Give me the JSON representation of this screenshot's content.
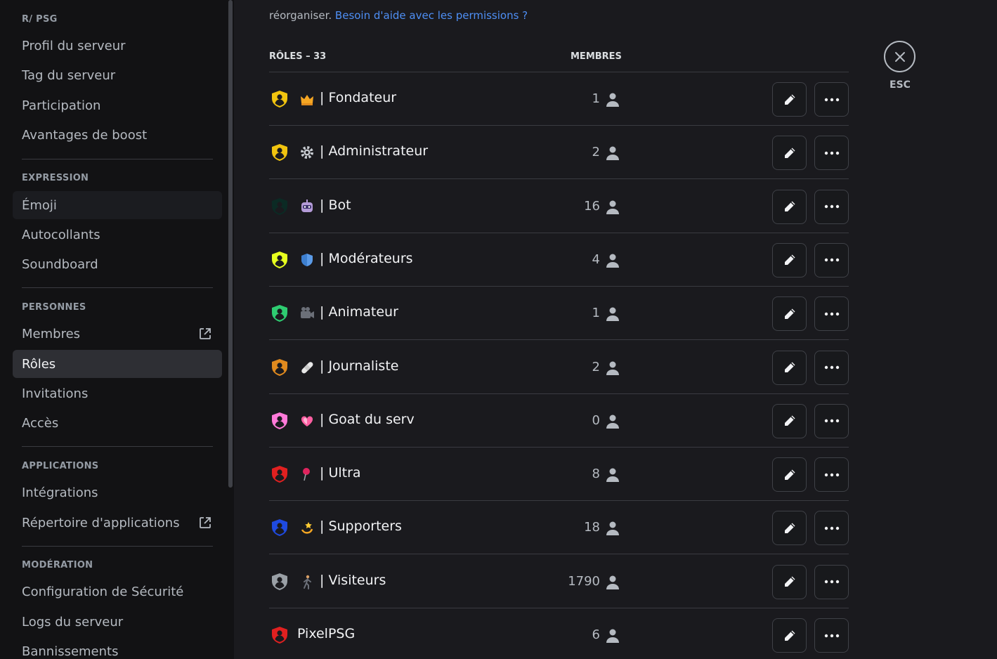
{
  "sidebar": {
    "server_name": "R/ PSG",
    "top_items": [
      "Profil du serveur",
      "Tag du serveur",
      "Participation",
      "Avantages de boost"
    ],
    "expression_header": "EXPRESSION",
    "expression_items": [
      "Émoji",
      "Autocollants",
      "Soundboard"
    ],
    "people_header": "PERSONNES",
    "people_items": [
      "Membres",
      "Rôles",
      "Invitations",
      "Accès"
    ],
    "apps_header": "APPLICATIONS",
    "apps_items": [
      "Intégrations",
      "Répertoire d'applications"
    ],
    "moderation_header": "MODÉRATION",
    "moderation_items": [
      "Configuration de Sécurité",
      "Logs du serveur",
      "Bannissements"
    ],
    "selected": "Rôles"
  },
  "main": {
    "intro_text": "réorganiser.",
    "help_link": "Besoin d'aide avec les permissions ?",
    "roles_header": "RÔLES – 33",
    "members_header": "MEMBRES",
    "esc_label": "ESC",
    "roles": [
      {
        "name": "| Fondateur",
        "members": "1",
        "color": "#f1c40f",
        "emoji": "crown-icon"
      },
      {
        "name": "| Administrateur",
        "members": "2",
        "color": "#f1c40f",
        "emoji": "gear-icon"
      },
      {
        "name": "| Bot",
        "members": "16",
        "color": "#0b2a24",
        "emoji": "robot-icon"
      },
      {
        "name": "| Modérateurs",
        "members": "4",
        "color": "#e7ff1f",
        "emoji": "shield-emoji-icon"
      },
      {
        "name": "| Animateur",
        "members": "1",
        "color": "#2ecc71",
        "emoji": "camera-icon"
      },
      {
        "name": "| Journaliste",
        "members": "2",
        "color": "#e08a1e",
        "emoji": "bandage-icon"
      },
      {
        "name": "| Goat du serv",
        "members": "0",
        "color": "#ff7ad9",
        "emoji": "heart-icon"
      },
      {
        "name": "| Ultra",
        "members": "8",
        "color": "#e02020",
        "emoji": "pin-icon"
      },
      {
        "name": "| Supporters",
        "members": "18",
        "color": "#1f4ae0",
        "emoji": "dizzy-icon"
      },
      {
        "name": "| Visiteurs",
        "members": "1790",
        "color": "#9aa0a6",
        "emoji": "walking-icon"
      },
      {
        "name": "PixelPSG",
        "members": "6",
        "color": "#e02020",
        "emoji": ""
      }
    ]
  }
}
